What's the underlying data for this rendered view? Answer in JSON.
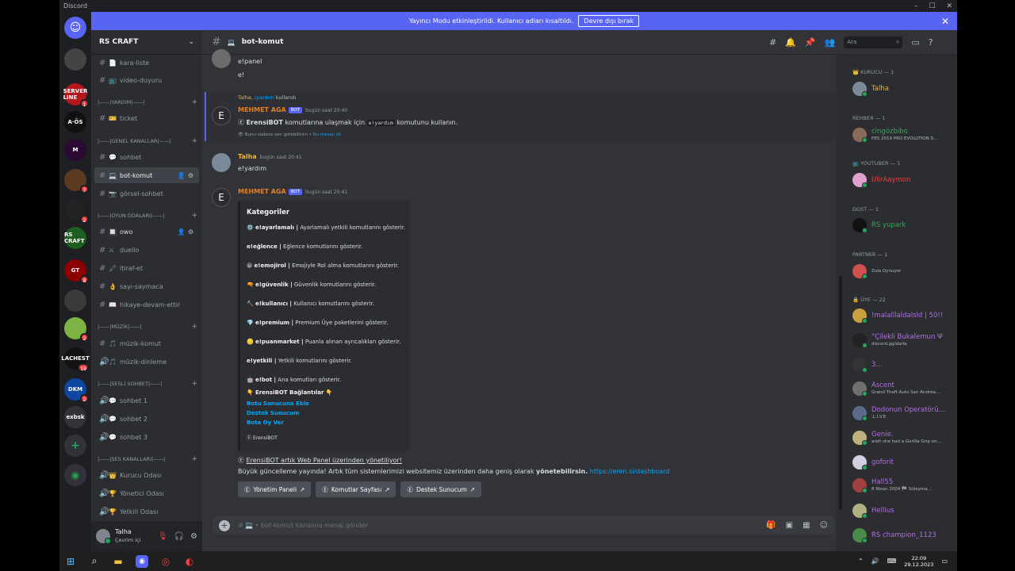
{
  "window": {
    "title": "Discord"
  },
  "banner": {
    "text": "Yayıncı Modu etkinleştirildi. Kullanıcı adları kısaltıldı.",
    "button": "Devre dışı bırak"
  },
  "guild": {
    "name": "RS CRAFT"
  },
  "servers": [
    {
      "label": "",
      "badge": "",
      "color": "#5865f2"
    },
    {
      "label": "",
      "badge": "",
      "color": "#444"
    },
    {
      "label": "SERVER LINE",
      "badge": "1",
      "color": "#b5161c"
    },
    {
      "label": "A·ÖS",
      "badge": "",
      "color": "#111"
    },
    {
      "label": "M",
      "badge": "",
      "color": "#2a0a30"
    },
    {
      "label": "",
      "badge": "7",
      "color": "#5a3a20"
    },
    {
      "label": "",
      "badge": "2",
      "color": "#222"
    },
    {
      "label": "RS CRAFT",
      "badge": "",
      "color": "#1b5e20"
    },
    {
      "label": "GT",
      "badge": "8",
      "color": "#8b0000"
    },
    {
      "label": "",
      "badge": "",
      "color": "#3a3a3a"
    },
    {
      "label": "",
      "badge": "2",
      "color": "#7cb342"
    },
    {
      "label": "LACHEST",
      "badge": "19",
      "color": "#111"
    },
    {
      "label": "DKM",
      "badge": "2",
      "color": "#0d47a1"
    },
    {
      "label": "exbsk",
      "badge": "",
      "color": "#313338"
    }
  ],
  "categories": {
    "yardim": "|——|YARDIM|——|",
    "genel": "|——|GENEL KANALLAR|——|",
    "oyun": "|——|OYUN ODALARI|——|",
    "muzik": "|——|MÜZİK|——|",
    "sesli": "|——|SESLİ SOHBET|——|",
    "ses": "|——|SES KANALLARI|——|"
  },
  "channels": {
    "kara_liste": "kara-liste",
    "video_duyuru": "video-duyuru",
    "ticket": "ticket",
    "sohbet": "sohbet",
    "bot_komut": "bot-komut",
    "gorsel_sohbet": "görsel-sohbet",
    "owo": "owo",
    "duello": "duello",
    "itiraf_et": "itiraf-et",
    "sayi_saymaca": "sayı-saymaca",
    "hikaye": "hikaye-devam-ettir",
    "muzik_komut": "müzik-komut",
    "muzik_dinleme": "müzik-dinleme",
    "sohbet1": "sohbet 1",
    "sohbet2": "sohbet 2",
    "sohbet3": "sohbet 3",
    "kurucu": "Kurucu Odası",
    "yonetici": "Yönetici Odası",
    "yetkili": "Yetkili Odası"
  },
  "user": {
    "name": "Talha",
    "status": "Çevrim içi"
  },
  "channel_header": {
    "name": "bot-komut",
    "search_placeholder": "Ara"
  },
  "messages": {
    "prev_line1": "e!panel",
    "prev_line2": "e!",
    "reply_user": "Talha",
    "reply_cmd": "/yardım",
    "reply_suffix": "kullandı",
    "m1_user": "MEHMET AGA",
    "bot_tag": "BOT",
    "m1_time": "bugün saat 20:40",
    "m1_text_a": "ErensiBOT",
    "m1_text_b": "komutlarına ulaşmak için",
    "m1_code": "e!yardım",
    "m1_text_c": "komutunu kullanın.",
    "m1_ephemeral": "Bunu sadece sen görebilirsin •",
    "m1_dismiss": "Bu mesajı sil",
    "m2_user": "Talha",
    "m2_time": "bugün saat 20:41",
    "m2_text": "e!yardım",
    "m3_user": "MEHMET AGA",
    "m3_time": "bugün saat 20:41"
  },
  "embed": {
    "title": "Kategoriler",
    "rows": [
      {
        "icon": "⚙️",
        "cmd": "e!ayarlamalı |",
        "desc": "Ayarlamalı yetkili komutlarını gösterir."
      },
      {
        "icon": "",
        "cmd": "e!eğlence |",
        "desc": "Eğlence komutlarını gösterir."
      },
      {
        "icon": "😀",
        "cmd": "e!emojirol |",
        "desc": "Emojiyle Rol alma komutlarını gösterir."
      },
      {
        "icon": "🔫",
        "cmd": "e!güvenlik |",
        "desc": "Güvenlik komutlarını gösterir."
      },
      {
        "icon": "🔨",
        "cmd": "e!kullanıcı |",
        "desc": "Kullanıcı komutlarını gösterir."
      },
      {
        "icon": "💎",
        "cmd": "e!premium |",
        "desc": "Premium Üye paketlerini gösterir."
      },
      {
        "icon": "🪙",
        "cmd": "e!puanmarket |",
        "desc": "Puanla alınan ayrıcalıkları gösterir."
      },
      {
        "icon": "",
        "cmd": "e!yetkili |",
        "desc": "Yetkili komutlarını gösterir."
      },
      {
        "icon": "🤖",
        "cmd": "e!bot |",
        "desc": "Ana komutları gösterir."
      }
    ],
    "links_title": "ErensiBOT Bağlantılar",
    "links": [
      "Botu Sunucuna Ekle",
      "Destek Sunucum",
      "Bota Oy Ver"
    ],
    "footer": "ErensiBOT"
  },
  "announcement": {
    "line1": "ErensiBOT artık Web Panel üzerinden yönetiliyor!",
    "line2a": "Büyük güncelleme yayında! Artık tüm sistemlerimizi websitemiz üzerinden daha geniş olarak",
    "line2b": "yönetebilirsin.",
    "link": "https://eren.si/dashboard",
    "buttons": [
      "Yönetim Paneli",
      "Komutlar Sayfası",
      "Destek Sunucum"
    ]
  },
  "composer": {
    "placeholder": "• bot-komut kanalına mesaj gönder"
  },
  "member_groups": {
    "kurucu": "KURUCU — 1",
    "rehber": "REHBER — 1",
    "youtuber": "YOUTUBER — 1",
    "dost": "DOST — 1",
    "partner": "PARTNER — 1",
    "uye": "ÜYE — 22"
  },
  "members": {
    "talha": {
      "name": "Talha",
      "sub": ""
    },
    "cingoz": {
      "name": "cingözbibo",
      "sub": "PES 2019 PRO EVOLUTION S..."
    },
    "yt": {
      "name": "UlirAaymon",
      "sub": ""
    },
    "yupark": {
      "name": "RS yupark",
      "sub": ""
    },
    "partner": {
      "name": "",
      "sub": "Zula Oynuyor"
    },
    "m1": {
      "name": "!malalllaldalsld | 50!!",
      "sub": ""
    },
    "m2": {
      "name": "°Çilekli Bukalemun Ψ",
      "sub": "discord.gg/darla"
    },
    "m3": {
      "name": "3...",
      "sub": ""
    },
    "m4": {
      "name": "Ascent",
      "sub": "Grand Theft Auto San Andrea..."
    },
    "m5": {
      "name": "Dodonun Operatörü...",
      "sub": ".L.İ.V.E."
    },
    "m6": {
      "name": "Genie.",
      "sub": "wish she had a Gorilla Grip on..."
    },
    "m7": {
      "name": "goforit",
      "sub": ""
    },
    "m8": {
      "name": "Hall55",
      "sub": "8 Nisan 2004 🏁 Süleyma..."
    },
    "m9": {
      "name": "Hellius",
      "sub": ""
    },
    "m10": {
      "name": "RS champion_1123",
      "sub": ""
    }
  },
  "taskbar": {
    "time": "22:09",
    "date": "29.12.2023"
  },
  "colors": {
    "blurple": "#5865f2",
    "bot_name": "#e67e22",
    "link": "#00a8fc",
    "online": "#23a55a"
  }
}
